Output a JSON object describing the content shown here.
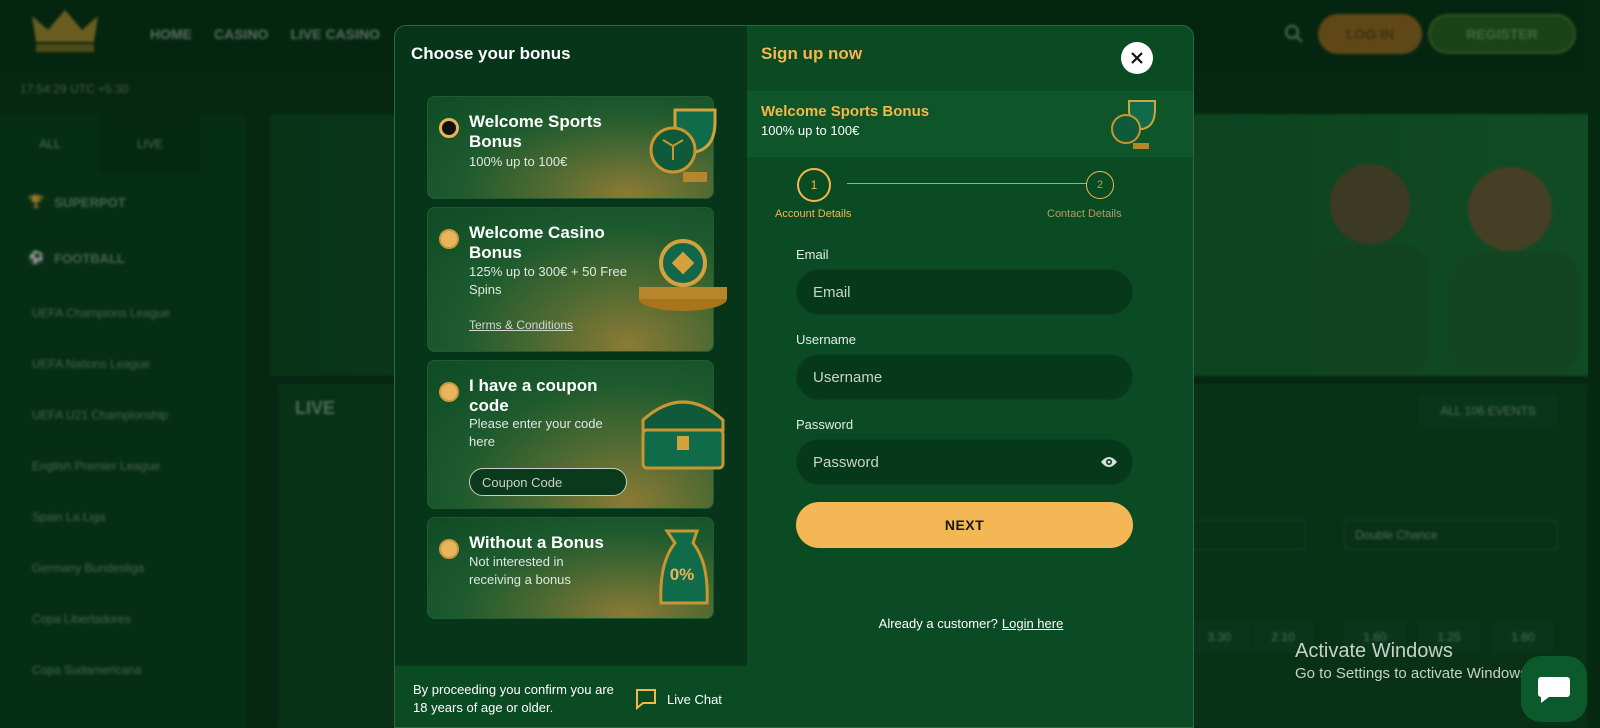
{
  "background": {
    "nav": [
      "HOME",
      "CASINO",
      "LIVE CASINO"
    ],
    "login_label": "LOG IN",
    "register_label": "REGISTER",
    "time": "17:54:29 UTC +5:30",
    "sidebar_tabs": [
      "ALL",
      "LIVE"
    ],
    "sidebar_categories": [
      "SUPERPOT",
      "FOOTBALL"
    ],
    "sidebar_leagues": [
      "UEFA Champions League",
      "UEFA Nations League",
      "UEFA U21 Championship",
      "English Premier League",
      "Spain La Liga",
      "Germany Bundesliga",
      "Copa Libertadores",
      "Copa Sudamericana"
    ],
    "live_title": "LIVE",
    "all_events": "ALL 106 EVENTS",
    "football_label": "FOOTBALL",
    "dropdown_2": "Double Chance",
    "odds_row": [
      "3.30",
      "2.10",
      "1.60",
      "1.25",
      "1.60"
    ]
  },
  "modal": {
    "left_heading": "Choose your bonus",
    "bonuses": [
      {
        "title": "Welcome Sports Bonus",
        "desc": "100% up to 100€",
        "selected": true
      },
      {
        "title": "Welcome Casino Bonus",
        "desc": "125% up to 300€ + 50 Free Spins",
        "link": "Terms & Conditions",
        "selected": false
      },
      {
        "title": "I have a coupon code",
        "desc": "Please enter your code here",
        "placeholder": "Coupon Code",
        "selected": false
      },
      {
        "title": "Without a Bonus",
        "desc": "Not interested in receiving a bonus",
        "art_text": "0%",
        "selected": false
      }
    ],
    "footer_text": "By proceeding you confirm you are 18 years of age or older.",
    "live_chat": "Live Chat",
    "right_heading": "Sign up now",
    "selected_bonus": {
      "title": "Welcome Sports Bonus",
      "desc": "100% up to 100€"
    },
    "steps": [
      {
        "num": "1",
        "label": "Account Details",
        "active": true
      },
      {
        "num": "2",
        "label": "Contact Details",
        "active": false
      }
    ],
    "fields": {
      "email_label": "Email",
      "email_placeholder": "Email",
      "username_label": "Username",
      "username_placeholder": "Username",
      "password_label": "Password",
      "password_placeholder": "Password"
    },
    "next_label": "NEXT",
    "already_text": "Already a customer?",
    "login_link": "Login here"
  },
  "windows_watermark": {
    "line1": "Activate Windows",
    "line2": "Go to Settings to activate Windows."
  },
  "colors": {
    "accent": "#f5b74b",
    "panel": "#0b4b24",
    "panel_dark": "#073519"
  }
}
